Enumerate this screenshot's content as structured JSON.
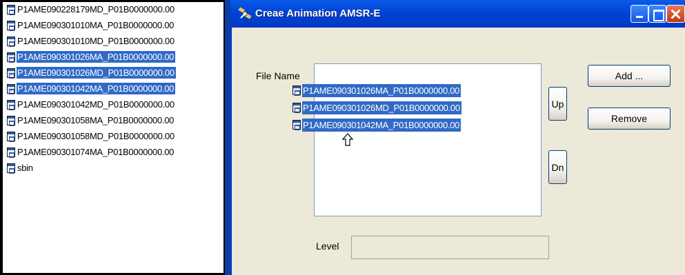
{
  "file_list": {
    "items": [
      {
        "label": "P1AME090228179MD_P01B0000000.00",
        "selected": false
      },
      {
        "label": "P1AME090301010MA_P01B0000000.00",
        "selected": false
      },
      {
        "label": "P1AME090301010MD_P01B0000000.00",
        "selected": false
      },
      {
        "label": "P1AME090301026MA_P01B0000000.00",
        "selected": true
      },
      {
        "label": "P1AME090301026MD_P01B0000000.00",
        "selected": true
      },
      {
        "label": "P1AME090301042MA_P01B0000000.00",
        "selected": true
      },
      {
        "label": "P1AME090301042MD_P01B0000000.00",
        "selected": false
      },
      {
        "label": "P1AME090301058MA_P01B0000000.00",
        "selected": false
      },
      {
        "label": "P1AME090301058MD_P01B0000000.00",
        "selected": false
      },
      {
        "label": "P1AME090301074MA_P01B0000000.00",
        "selected": false
      },
      {
        "label": "sbin",
        "selected": false
      }
    ]
  },
  "dialog": {
    "title": "Creae Animation AMSR-E",
    "file_name_label": "File Name",
    "dragged_files": [
      "P1AME090301026MA_P01B0000000.00",
      "P1AME090301026MD_P01B0000000.00",
      "P1AME090301042MA_P01B0000000.00"
    ],
    "buttons": {
      "add": "Add ...",
      "remove": "Remove",
      "up": "Up",
      "down": "Dn"
    },
    "level_label": "Level",
    "level_value": ""
  },
  "colors": {
    "selection": "#316ac5",
    "titlebar": "#0044d4",
    "dialog_bg": "#ece9d8"
  }
}
